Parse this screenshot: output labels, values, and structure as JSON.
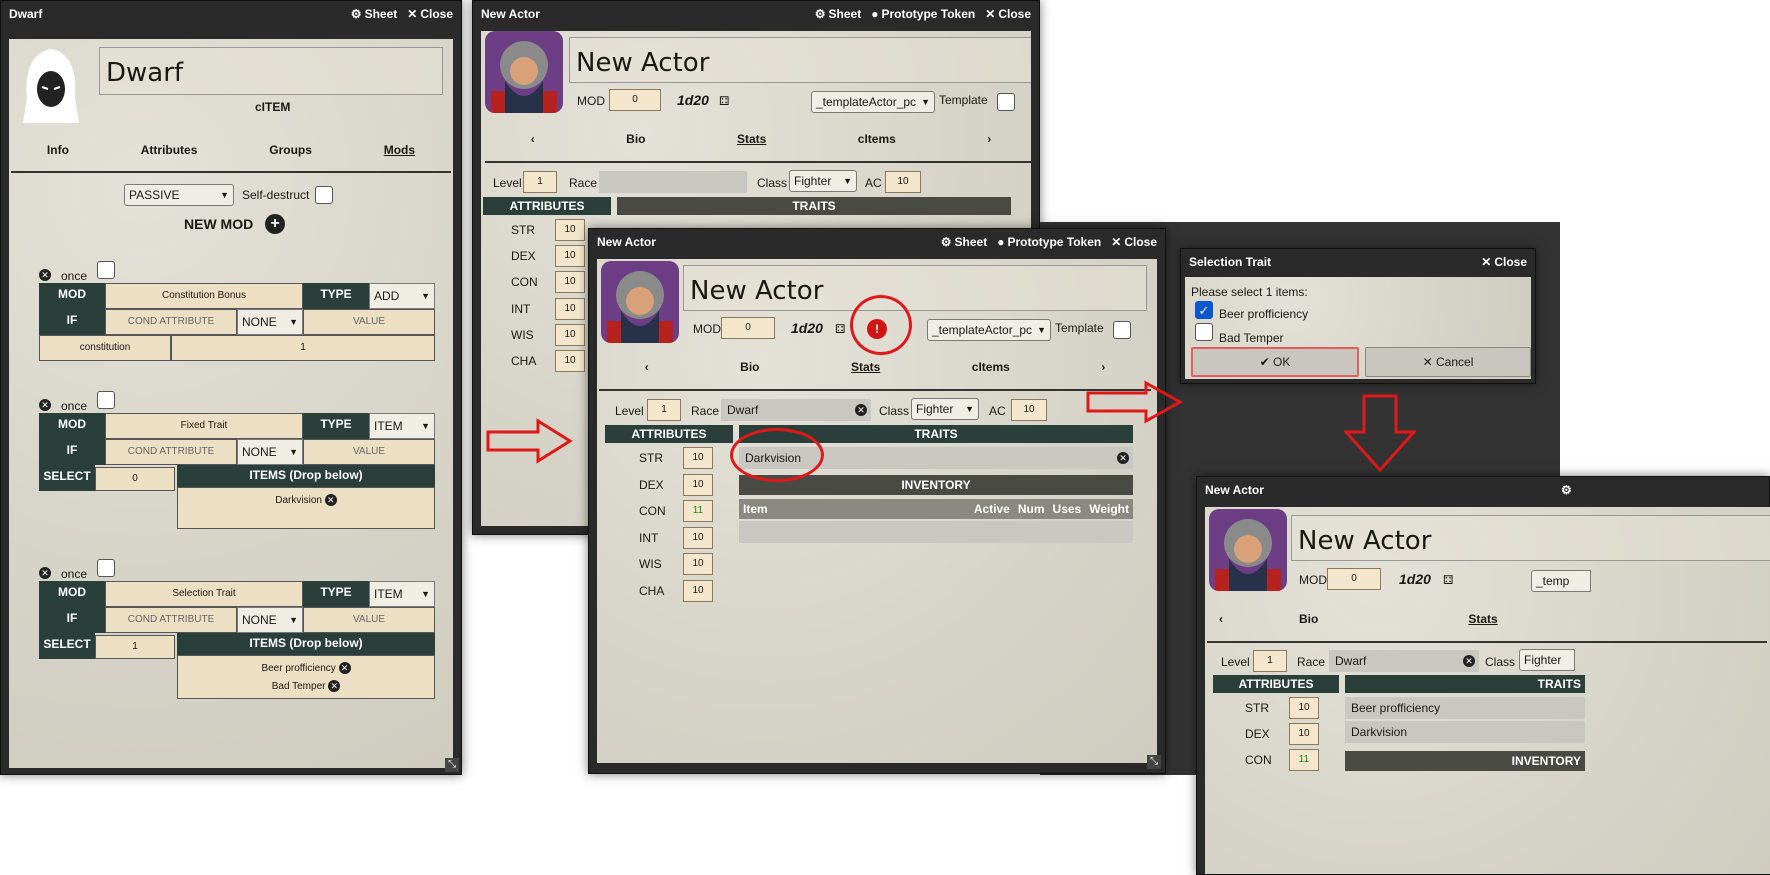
{
  "dwarf_window": {
    "title": "Dwarf",
    "sheet_label": "Sheet",
    "close_label": "Close",
    "name": "Dwarf",
    "type_label": "cITEM",
    "tabs": [
      "Info",
      "Attributes",
      "Groups",
      "Mods"
    ],
    "mode_select": "PASSIVE",
    "self_destruct_label": "Self-destruct",
    "new_mod_label": "NEW MOD",
    "mods": [
      {
        "once": "once",
        "mod_label": "MOD",
        "name": "Constitution Bonus",
        "type_label": "TYPE",
        "type": "ADD",
        "if_label": "IF",
        "cond": "COND ATTRIBUTE",
        "cond_op": "NONE",
        "value": "VALUE",
        "attr": "constitution",
        "attr_value": "1"
      },
      {
        "once": "once",
        "mod_label": "MOD",
        "name": "Fixed Trait",
        "type_label": "TYPE",
        "type": "ITEM",
        "if_label": "IF",
        "cond": "COND ATTRIBUTE",
        "cond_op": "NONE",
        "value": "VALUE",
        "select_label": "SELECT",
        "select_value": "0",
        "items_label": "ITEMS (Drop below)",
        "items": [
          "Darkvision"
        ]
      },
      {
        "once": "once",
        "mod_label": "MOD",
        "name": "Selection Trait",
        "type_label": "TYPE",
        "type": "ITEM",
        "if_label": "IF",
        "cond": "COND ATTRIBUTE",
        "cond_op": "NONE",
        "value": "VALUE",
        "select_label": "SELECT",
        "select_value": "1",
        "items_label": "ITEMS (Drop below)",
        "items": [
          "Beer profficiency",
          "Bad Temper"
        ]
      }
    ]
  },
  "actor_window": {
    "title": "New Actor",
    "sheet_label": "Sheet",
    "token_label": "Prototype Token",
    "close_label": "Close",
    "name": "New Actor",
    "mod_label": "MOD",
    "mod_value": "0",
    "dice": "1d20",
    "template_select": "_templateActor_pc",
    "template_label": "Template",
    "tabs": [
      "Bio",
      "Stats",
      "cItems"
    ],
    "level_label": "Level",
    "level": "1",
    "race_label": "Race",
    "race": "Dwarf",
    "class_label": "Class",
    "class": "Fighter",
    "ac_label": "AC",
    "ac": "10",
    "attributes_label": "ATTRIBUTES",
    "traits_label": "TRAITS",
    "inventory_label": "INVENTORY",
    "inventory_cols": [
      "Item",
      "Active",
      "Num",
      "Uses",
      "Weight"
    ],
    "attributes": [
      {
        "name": "STR",
        "value": "10"
      },
      {
        "name": "DEX",
        "value": "10"
      },
      {
        "name": "CON",
        "value": "10"
      },
      {
        "name": "INT",
        "value": "10"
      },
      {
        "name": "WIS",
        "value": "10"
      },
      {
        "name": "CHA",
        "value": "10"
      }
    ],
    "con_after": "11",
    "trait_darkvision": "Darkvision",
    "trait_beer": "Beer profficiency",
    "template_cut": "_temp"
  },
  "selection_dialog": {
    "title": "Selection Trait",
    "close_label": "Close",
    "prompt": "Please select 1 items:",
    "options": [
      {
        "label": "Beer profficiency",
        "checked": true
      },
      {
        "label": "Bad Temper",
        "checked": false
      }
    ],
    "ok_label": "OK",
    "cancel_label": "Cancel"
  }
}
